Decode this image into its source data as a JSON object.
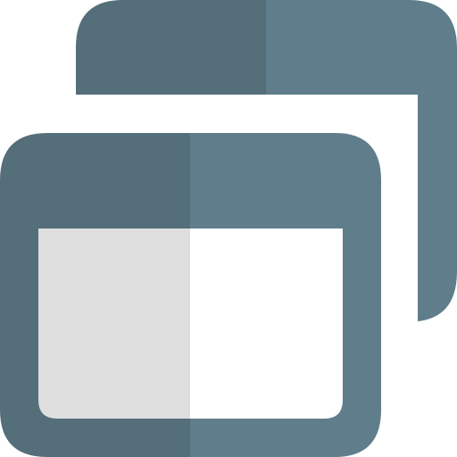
{
  "icon": {
    "name": "multiple-windows-icon",
    "colors": {
      "frame_dark": "#546e7a",
      "frame_light": "#607d8b",
      "content_left": "#dedede",
      "content_right": "#ffffff",
      "background": "#ffffff"
    }
  }
}
